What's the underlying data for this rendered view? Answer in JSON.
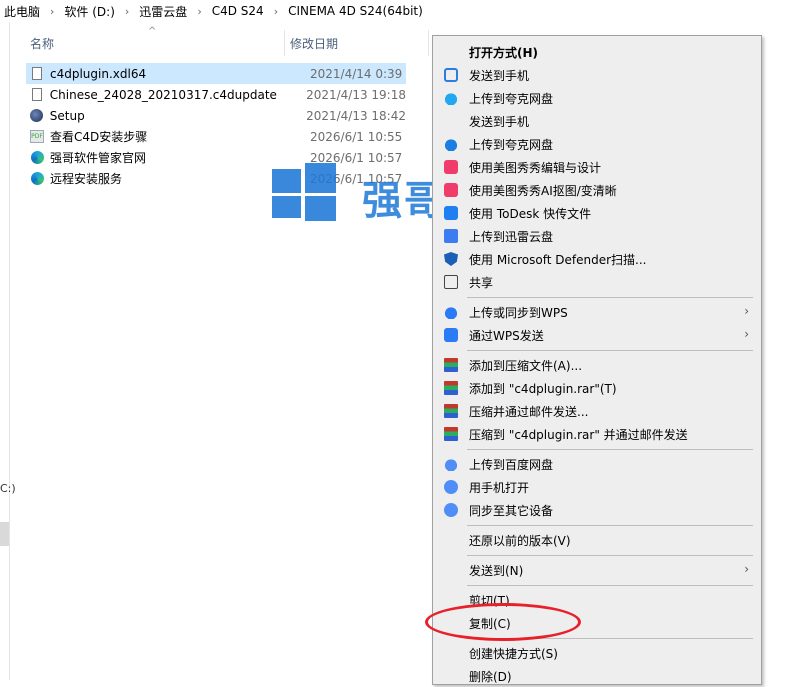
{
  "breadcrumb": [
    "此电脑",
    "软件 (D:)",
    "迅雷云盘",
    "C4D S24",
    "CINEMA 4D S24(64bit)"
  ],
  "left_pane_fragment": "C:)",
  "columns": {
    "name": "名称",
    "date": "修改日期"
  },
  "files": [
    {
      "name": "c4dplugin.xdl64",
      "date": "2021/4/14 0:39",
      "icon": "document-icon",
      "selected": true
    },
    {
      "name": "Chinese_24028_20210317.c4dupdate",
      "date": "2021/4/13 19:18",
      "icon": "document-icon",
      "selected": false
    },
    {
      "name": "Setup",
      "date": "2021/4/13 18:42",
      "icon": "cinema4d-icon",
      "selected": false
    },
    {
      "name": "查看C4D安装步骤",
      "date": "2026/6/1 10:55",
      "icon": "pdf-icon",
      "selected": false
    },
    {
      "name": "强哥软件管家官网",
      "date": "2026/6/1 10:57",
      "icon": "edge-icon",
      "selected": false
    },
    {
      "name": "远程安装服务",
      "date": "2026/6/1 10:57",
      "icon": "edge-icon",
      "selected": false
    }
  ],
  "watermark": {
    "text": "强哥软件管家",
    "color": "#1e78d7"
  },
  "context_menu": {
    "items": [
      {
        "label": "打开方式(H)",
        "icon": "",
        "bold": true
      },
      {
        "label": "发送到手机",
        "icon": "phone-icon"
      },
      {
        "label": "上传到夸克网盘",
        "icon": "quark-cloud-icon"
      },
      {
        "label": "发送到手机",
        "icon": ""
      },
      {
        "label": "上传到夸克网盘",
        "icon": "quark-cloud-icon"
      },
      {
        "label": "使用美图秀秀编辑与设计",
        "icon": "meitu-icon"
      },
      {
        "label": "使用美图秀秀AI抠图/变清晰",
        "icon": "meitu-icon"
      },
      {
        "label": "使用 ToDesk 快传文件",
        "icon": "todesk-icon"
      },
      {
        "label": "上传到迅雷云盘",
        "icon": "xunlei-icon"
      },
      {
        "label": "使用 Microsoft Defender扫描...",
        "icon": "defender-shield-icon"
      },
      {
        "label": "共享",
        "icon": "share-icon"
      },
      {
        "label": "上传或同步到WPS",
        "icon": "wps-cloud-icon",
        "submenu": true
      },
      {
        "label": "通过WPS发送",
        "icon": "wps-send-icon",
        "submenu": true
      },
      {
        "label": "添加到压缩文件(A)...",
        "icon": "winrar-icon"
      },
      {
        "label": "添加到 \"c4dplugin.rar\"(T)",
        "icon": "winrar-icon"
      },
      {
        "label": "压缩并通过邮件发送...",
        "icon": "winrar-icon"
      },
      {
        "label": "压缩到 \"c4dplugin.rar\" 并通过邮件发送",
        "icon": "winrar-icon"
      },
      {
        "label": "上传到百度网盘",
        "icon": "baidu-cloud-icon"
      },
      {
        "label": "用手机打开",
        "icon": "baidu-phone-icon"
      },
      {
        "label": "同步至其它设备",
        "icon": "baidu-sync-icon"
      },
      {
        "label": "还原以前的版本(V)",
        "icon": ""
      },
      {
        "label": "发送到(N)",
        "icon": "",
        "submenu": true
      },
      {
        "label": "剪切(T)",
        "icon": ""
      },
      {
        "label": "复制(C)",
        "icon": "",
        "highlighted": true
      },
      {
        "label": "创建快捷方式(S)",
        "icon": ""
      },
      {
        "label": "删除(D)",
        "icon": ""
      }
    ],
    "submenu_arrow": "›"
  },
  "highlight_color": "#e8202a"
}
